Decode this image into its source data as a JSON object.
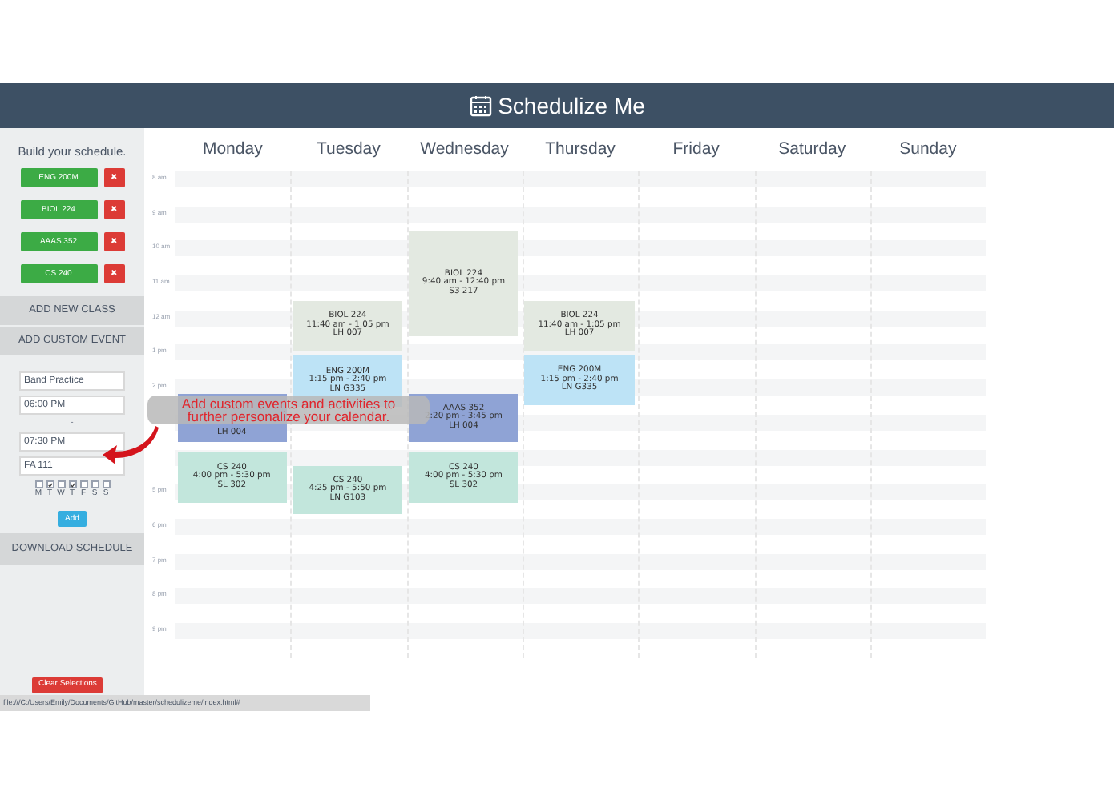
{
  "header": {
    "title": "Schedulize Me"
  },
  "sidebar": {
    "heading": "Build your schedule.",
    "classes": [
      {
        "name": "ENG 200M",
        "remove": "✖"
      },
      {
        "name": "BIOL 224",
        "remove": "✖"
      },
      {
        "name": "AAAS 352",
        "remove": "✖"
      },
      {
        "name": "CS 240",
        "remove": "✖"
      }
    ],
    "add_class": "ADD NEW CLASS",
    "add_event": "ADD CUSTOM EVENT",
    "form": {
      "name": "Band Practice",
      "start": "06:00 PM",
      "separator": "-",
      "end": "07:30 PM",
      "location": "FA 111",
      "days": [
        {
          "label": "M",
          "checked": false
        },
        {
          "label": "T",
          "checked": true
        },
        {
          "label": "W",
          "checked": false
        },
        {
          "label": "T",
          "checked": true
        },
        {
          "label": "F",
          "checked": false
        },
        {
          "label": "S",
          "checked": false
        },
        {
          "label": "S",
          "checked": false
        }
      ],
      "submit": "Add"
    },
    "download": "DOWNLOAD SCHEDULE",
    "clear": "Clear Selections"
  },
  "calendar": {
    "hours": [
      {
        "label": "8 am"
      },
      {
        "label": "9 am"
      },
      {
        "label": "10 am"
      },
      {
        "label": "11 am"
      },
      {
        "label": "12 am"
      },
      {
        "label": "1 pm"
      },
      {
        "label": "2 pm"
      },
      {
        "label": "5 pm"
      },
      {
        "label": "6 pm"
      },
      {
        "label": "7 pm"
      },
      {
        "label": "8 pm"
      },
      {
        "label": "9 pm"
      }
    ],
    "days": [
      {
        "name": "Monday",
        "events": [
          {
            "lines": [
              "LH 004"
            ],
            "color": "#8fa3d5"
          },
          {
            "lines": [
              "CS 240",
              "4:00 pm - 5:30 pm",
              "SL 302"
            ],
            "color": "#c2e6dc"
          }
        ]
      },
      {
        "name": "Tuesday",
        "events": [
          {
            "lines": [
              "BIOL 224",
              "11:40 am - 1:05 pm",
              "LH 007"
            ],
            "color": "#e3e9e1"
          },
          {
            "lines": [
              "ENG 200M",
              "1:15 pm - 2:40 pm",
              "LN G335"
            ],
            "color": "#bde3f6"
          },
          {
            "lines": [
              "CS 240",
              "4:25 pm - 5:50 pm",
              "LN G103"
            ],
            "color": "#c2e6dc"
          }
        ]
      },
      {
        "name": "Wednesday",
        "events": [
          {
            "lines": [
              "BIOL 224",
              "9:40 am - 12:40 pm",
              "S3 217"
            ],
            "color": "#e3e9e1"
          },
          {
            "lines": [
              "AAAS 352",
              "2:20 pm - 3:45 pm",
              "LH 004"
            ],
            "color": "#8fa3d5"
          },
          {
            "lines": [
              "CS 240",
              "4:00 pm - 5:30 pm",
              "SL 302"
            ],
            "color": "#c2e6dc"
          }
        ]
      },
      {
        "name": "Thursday",
        "events": [
          {
            "lines": [
              "BIOL 224",
              "11:40 am - 1:05 pm",
              "LH 007"
            ],
            "color": "#e3e9e1"
          },
          {
            "lines": [
              "ENG 200M",
              "1:15 pm - 2:40 pm",
              "LN G335"
            ],
            "color": "#bde3f6"
          }
        ]
      },
      {
        "name": "Friday"
      },
      {
        "name": "Saturday"
      },
      {
        "name": "Sunday"
      }
    ]
  },
  "callout": {
    "text": "Add custom events and activities to further personalize your calendar."
  },
  "status_bar": {
    "url": "file:///C:/Users/Emily/Documents/GitHub/master/schedulizeme/index.html#"
  }
}
